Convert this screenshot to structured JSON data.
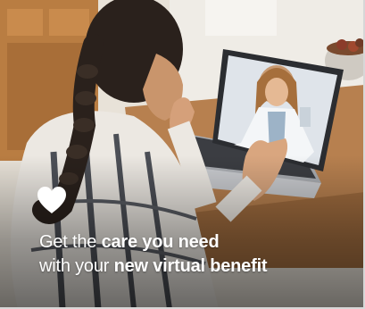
{
  "banner": {
    "icon": "heart-icon",
    "line1": {
      "regular": "Get the ",
      "bold": "care you need"
    },
    "line2": {
      "regular": "with your ",
      "bold": "new virtual benefit"
    }
  },
  "colors": {
    "text": "#ffffff",
    "laptop_body": "#c9cbcf",
    "table": "#b07a4e",
    "wall": "#e9e4dc"
  }
}
